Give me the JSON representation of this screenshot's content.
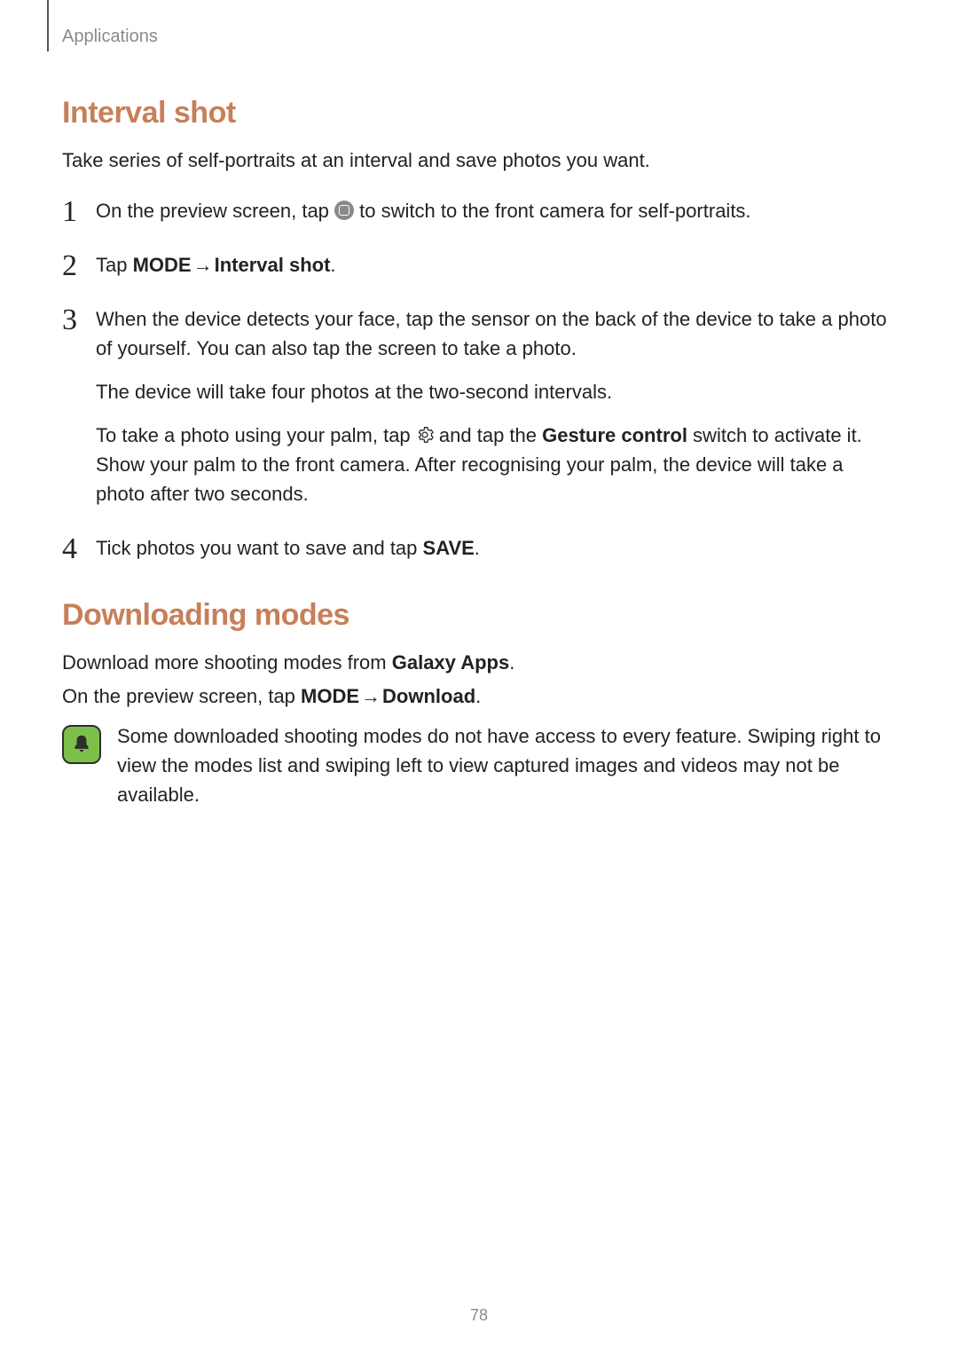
{
  "breadcrumb": "Applications",
  "page_number": "78",
  "section1": {
    "title": "Interval shot",
    "intro": "Take series of self-portraits at an interval and save photos you want.",
    "steps": {
      "s1": {
        "num": "1",
        "before_icon": "On the preview screen, tap ",
        "after_icon": " to switch to the front camera for self-portraits.",
        "icon_name": "switch-camera-icon"
      },
      "s2": {
        "num": "2",
        "prefix": "Tap ",
        "mode": "MODE",
        "arrow": " → ",
        "target": "Interval shot",
        "suffix": "."
      },
      "s3": {
        "num": "3",
        "p1": "When the device detects your face, tap the sensor on the back of the device to take a photo of yourself. You can also tap the screen to take a photo.",
        "p2": "The device will take four photos at the two-second intervals.",
        "p3_before": "To take a photo using your palm, tap ",
        "p3_mid1": " and tap the ",
        "p3_bold": "Gesture control",
        "p3_after": " switch to activate it. Show your palm to the front camera. After recognising your palm, the device will take a photo after two seconds."
      },
      "s4": {
        "num": "4",
        "prefix": "Tick photos you want to save and tap ",
        "save": "SAVE",
        "suffix": "."
      }
    }
  },
  "section2": {
    "title": "Downloading modes",
    "line1_prefix": "Download more shooting modes from ",
    "line1_bold": "Galaxy Apps",
    "line1_suffix": ".",
    "line2_prefix": "On the preview screen, tap ",
    "line2_mode": "MODE",
    "line2_arrow": " → ",
    "line2_download": "Download",
    "line2_suffix": ".",
    "note": "Some downloaded shooting modes do not have access to every feature. Swiping right to view the modes list and swiping left to view captured images and videos may not be available."
  }
}
